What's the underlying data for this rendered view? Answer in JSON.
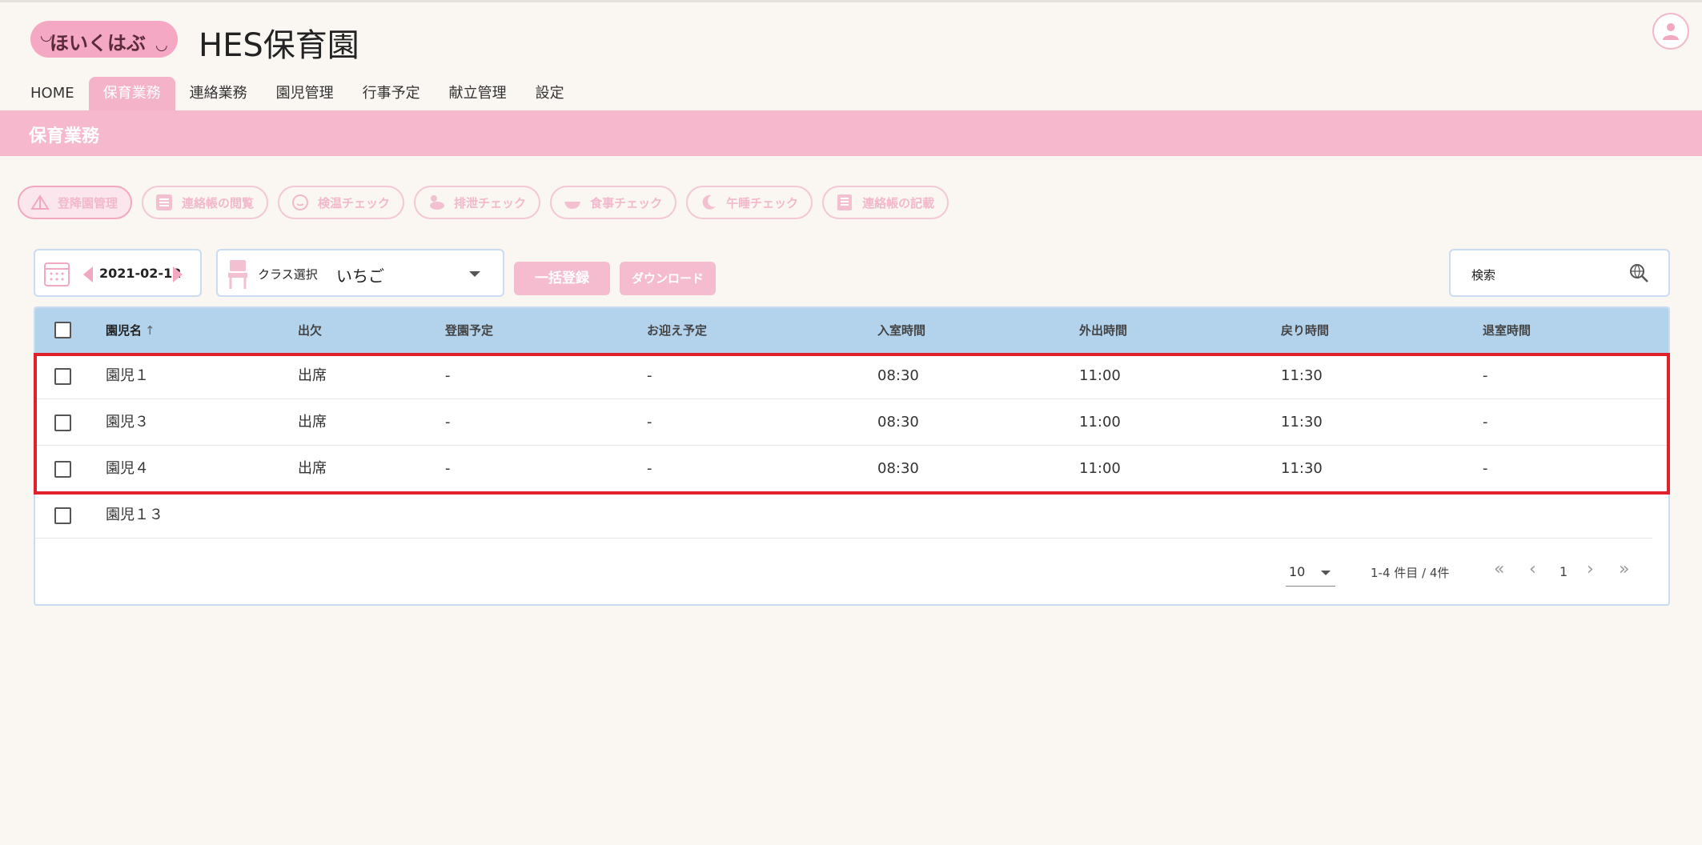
{
  "brand": {
    "logo_text": "ほいくはぶ",
    "site_title": "HES保育園"
  },
  "nav": {
    "tabs": [
      {
        "label": "HOME",
        "active": false
      },
      {
        "label": "保育業務",
        "active": true
      },
      {
        "label": "連絡業務",
        "active": false
      },
      {
        "label": "園児管理",
        "active": false
      },
      {
        "label": "行事予定",
        "active": false
      },
      {
        "label": "献立管理",
        "active": false
      },
      {
        "label": "設定",
        "active": false
      }
    ]
  },
  "page_header": {
    "title": "保育業務"
  },
  "shortcuts": [
    {
      "label": "登降園管理",
      "icon": "tent-icon",
      "active": true
    },
    {
      "label": "連絡帳の閲覧",
      "icon": "list-icon",
      "active": false
    },
    {
      "label": "検温チェック",
      "icon": "thermometer-face-icon",
      "active": false
    },
    {
      "label": "排泄チェック",
      "icon": "duck-icon",
      "active": false
    },
    {
      "label": "食事チェック",
      "icon": "bowl-icon",
      "active": false
    },
    {
      "label": "午睡チェック",
      "icon": "moon-icon",
      "active": false
    },
    {
      "label": "連絡帳の記載",
      "icon": "notebook-icon",
      "active": false
    }
  ],
  "toolbar": {
    "date": "2021-02-12",
    "class_label": "クラス選択",
    "class_value": "いちご",
    "bulk_button": "一括登録",
    "download_button": "ダウンロード",
    "search_placeholder": "検索"
  },
  "table": {
    "columns": [
      "園児名",
      "出欠",
      "登園予定",
      "お迎え予定",
      "入室時間",
      "外出時間",
      "戻り時間",
      "退室時間"
    ],
    "rows": [
      {
        "name": "園児１",
        "attendance": "出席",
        "arrival_plan": "-",
        "pickup_plan": "-",
        "enter": "08:30",
        "out": "11:00",
        "back": "11:30",
        "leave": "-"
      },
      {
        "name": "園児３",
        "attendance": "出席",
        "arrival_plan": "-",
        "pickup_plan": "-",
        "enter": "08:30",
        "out": "11:00",
        "back": "11:30",
        "leave": "-"
      },
      {
        "name": "園児４",
        "attendance": "出席",
        "arrival_plan": "-",
        "pickup_plan": "-",
        "enter": "08:30",
        "out": "11:00",
        "back": "11:30",
        "leave": "-"
      },
      {
        "name": "園児１３",
        "attendance": "",
        "arrival_plan": "",
        "pickup_plan": "",
        "enter": "",
        "out": "",
        "back": "",
        "leave": ""
      }
    ]
  },
  "pagination": {
    "page_size": "10",
    "range": "1-4 件目 / 4件",
    "current_page": "1"
  },
  "colors": {
    "accent_pink": "#f5b3c9",
    "header_blue": "#b3d2ec",
    "highlight_red": "#e0202a"
  }
}
